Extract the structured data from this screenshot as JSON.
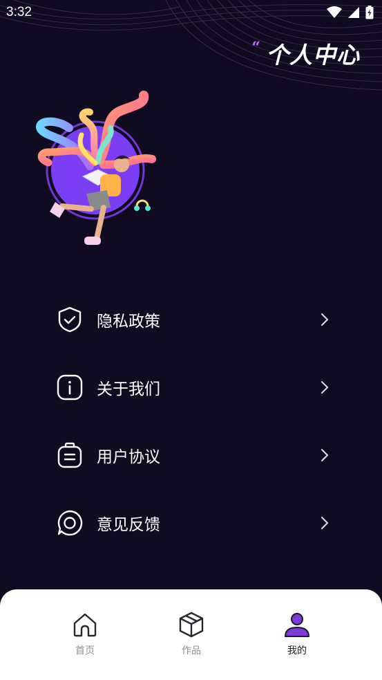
{
  "status_bar": {
    "time": "3:32",
    "icons": [
      "wifi-icon",
      "signal-icon",
      "battery-icon"
    ]
  },
  "header": {
    "quote": "“",
    "title": "个人中心"
  },
  "illustration": {
    "name": "person-reading-book-illustration"
  },
  "menu": {
    "items": [
      {
        "label": "隐私政策",
        "icon": "shield-check-icon"
      },
      {
        "label": "关于我们",
        "icon": "info-icon"
      },
      {
        "label": "用户协议",
        "icon": "clipboard-icon"
      },
      {
        "label": "意见反馈",
        "icon": "chat-bubble-icon"
      }
    ]
  },
  "bottom_nav": {
    "items": [
      {
        "label": "首页",
        "icon": "home-icon",
        "active": false
      },
      {
        "label": "作品",
        "icon": "cube-icon",
        "active": false
      },
      {
        "label": "我的",
        "icon": "user-icon",
        "active": true
      }
    ]
  },
  "colors": {
    "background": "#110b22",
    "accent": "#8b45ff",
    "quote": "#c86cff",
    "nav_bg": "#ffffff",
    "nav_inactive": "#8f8f98",
    "nav_active": "#1a1a22"
  }
}
